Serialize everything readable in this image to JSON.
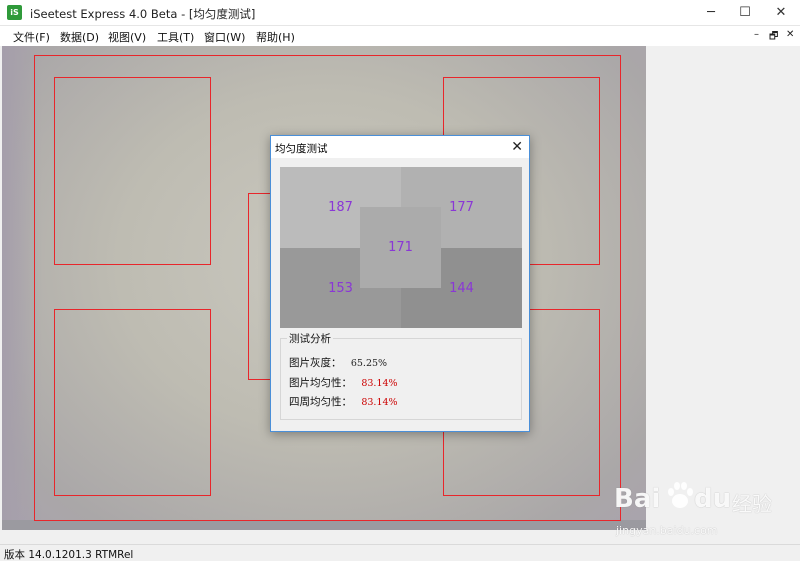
{
  "window": {
    "title": "iSeetest Express 4.0 Beta - [均匀度测试]",
    "app_icon_text": "iS",
    "controls": {
      "minimize": "─",
      "maximize": "☐",
      "close": "✕"
    }
  },
  "menu": {
    "items": [
      "文件(F)",
      "数据(D)",
      "视图(V)",
      "工具(T)",
      "窗口(W)",
      "帮助(H)"
    ],
    "mdi_controls": {
      "minimize": "–",
      "restore": "🗗",
      "close": "✕"
    }
  },
  "dialog": {
    "title": "均匀度测试",
    "close": "✕",
    "quadrants": {
      "top_left": "187",
      "top_right": "177",
      "center": "171",
      "bottom_left": "153",
      "bottom_right": "144"
    },
    "quadrant_colors": {
      "top_left": "#bbbbbb",
      "top_right": "#b1b1b1",
      "center": "#ababab",
      "bottom_left": "#999999",
      "bottom_right": "#909090",
      "value_text": "#8a37d6"
    },
    "analysis": {
      "group_title": "测试分析",
      "rows": [
        {
          "label": "图片灰度：",
          "value": "65.25%",
          "color": "#222222"
        },
        {
          "label": "图片均匀性：",
          "value": "83.14%",
          "color": "#cc0000"
        },
        {
          "label": "四周均匀性：",
          "value": "83.14%",
          "color": "#cc0000"
        }
      ]
    }
  },
  "status": {
    "text": "版本 14.0.1201.3 RTMRel"
  },
  "watermark": {
    "brand": "Bai",
    "brand_suffix": "du",
    "cn": "经验",
    "url": "jingyan.baidu.com"
  },
  "colors": {
    "roi_red": "#e8262b",
    "dialog_border": "#4a8fd8"
  }
}
